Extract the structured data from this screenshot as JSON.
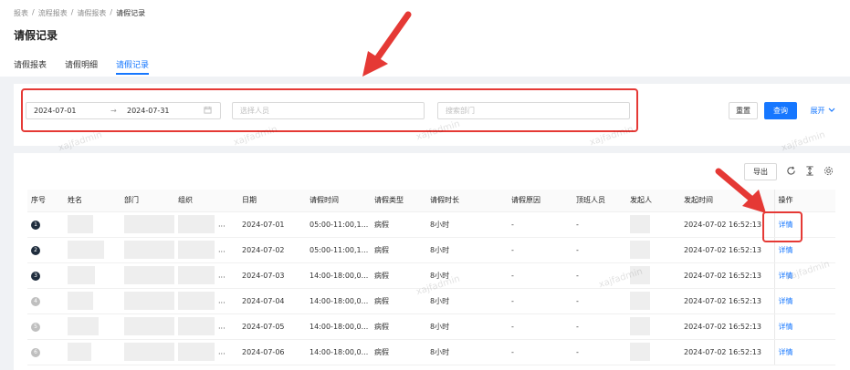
{
  "breadcrumb": [
    "报表",
    "流程报表",
    "请假报表",
    "请假记录"
  ],
  "breadcrumb_sep": "/",
  "page_title": "请假记录",
  "tabs": [
    {
      "label": "请假报表",
      "active": false
    },
    {
      "label": "请假明细",
      "active": false
    },
    {
      "label": "请假记录",
      "active": true
    }
  ],
  "filters": {
    "date_start": "2024-07-01",
    "date_end": "2024-07-31",
    "range_arrow": "→",
    "person_placeholder": "选择人员",
    "dept_placeholder": "搜索部门",
    "reset_label": "重置",
    "search_label": "查询",
    "expand_label": "展开"
  },
  "toolbar": {
    "export_label": "导出"
  },
  "table": {
    "columns": [
      "序号",
      "姓名",
      "部门",
      "组织",
      "日期",
      "请假时间",
      "请假类型",
      "请假时长",
      "请假原因",
      "顶班人员",
      "发起人",
      "发起时间",
      "操作"
    ],
    "rows": [
      {
        "no": "1",
        "org": "...",
        "date": "2024-07-01",
        "time": "05:00-11:00,1...",
        "type": "病假",
        "duration": "8小时",
        "reason": "-",
        "sub": "-",
        "created": "2024-07-02 16:52:13",
        "action": "详情"
      },
      {
        "no": "2",
        "org": "...",
        "date": "2024-07-02",
        "time": "05:00-11:00,1...",
        "type": "病假",
        "duration": "8小时",
        "reason": "-",
        "sub": "-",
        "created": "2024-07-02 16:52:13",
        "action": "详情"
      },
      {
        "no": "3",
        "org": "...",
        "date": "2024-07-03",
        "time": "14:00-18:00,0...",
        "type": "病假",
        "duration": "8小时",
        "reason": "-",
        "sub": "-",
        "created": "2024-07-02 16:52:13",
        "action": "详情"
      },
      {
        "no": "4",
        "org": "...",
        "date": "2024-07-04",
        "time": "14:00-18:00,0...",
        "type": "病假",
        "duration": "8小时",
        "reason": "-",
        "sub": "-",
        "created": "2024-07-02 16:52:13",
        "action": "详情"
      },
      {
        "no": "5",
        "org": "...",
        "date": "2024-07-05",
        "time": "14:00-18:00,0...",
        "type": "病假",
        "duration": "8小时",
        "reason": "-",
        "sub": "-",
        "created": "2024-07-02 16:52:13",
        "action": "详情"
      },
      {
        "no": "6",
        "org": "...",
        "date": "2024-07-06",
        "time": "14:00-18:00,0...",
        "type": "病假",
        "duration": "8小时",
        "reason": "-",
        "sub": "-",
        "created": "2024-07-02 16:52:13",
        "action": "详情"
      }
    ]
  },
  "watermark_text": "xajfadmin",
  "colors": {
    "primary": "#1677ff",
    "annotation": "#e53935"
  },
  "icons": [
    "calendar-icon",
    "chevron-down-icon",
    "refresh-icon",
    "column-height-icon",
    "settings-icon",
    "arrow-annotation"
  ]
}
